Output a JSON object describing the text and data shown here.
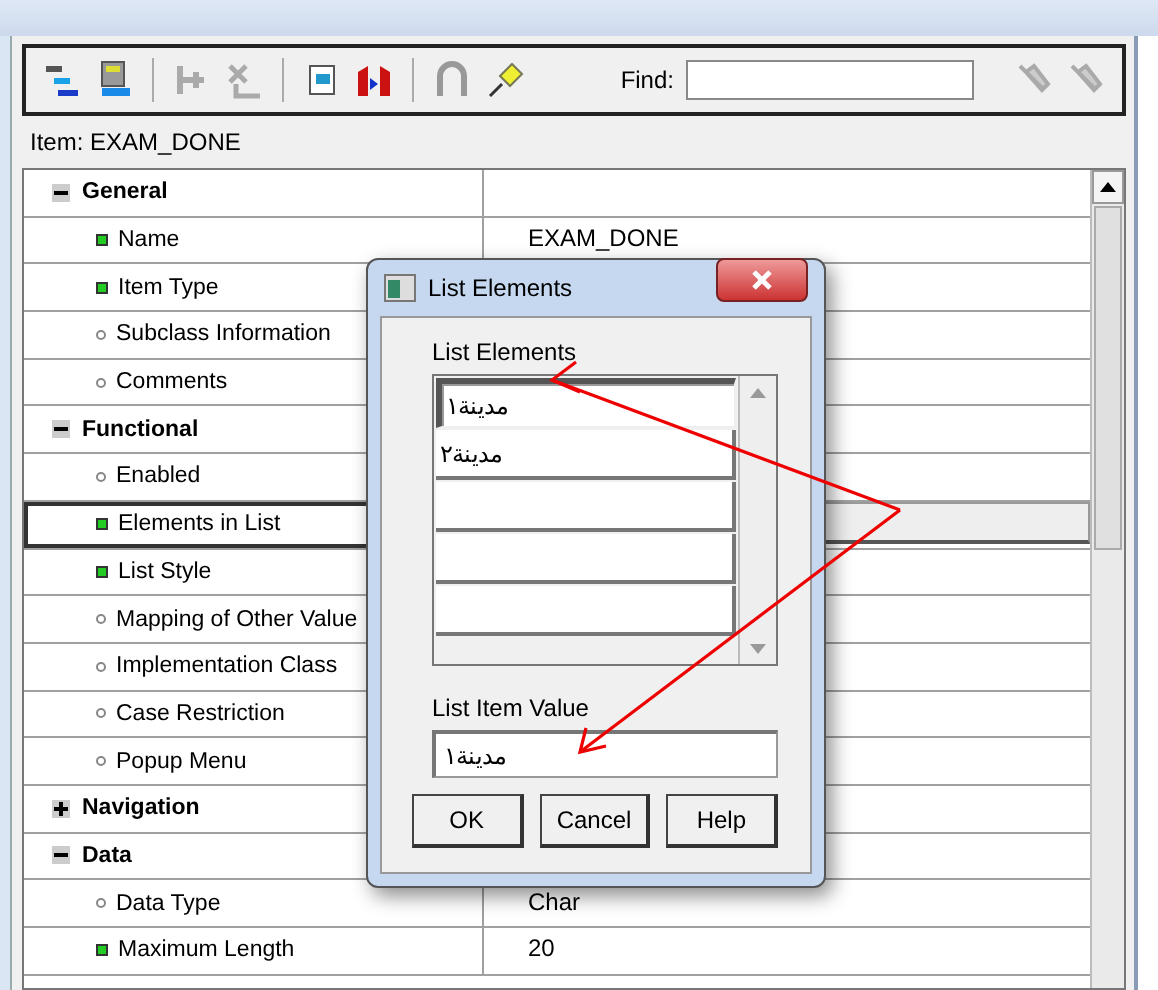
{
  "toolbar": {
    "find": {
      "label": "Find:"
    }
  },
  "item": {
    "label": "Item: EXAM_DONE"
  },
  "properties": [
    {
      "kind": "section",
      "label": "General",
      "expanded": true
    },
    {
      "kind": "property",
      "label": "Name",
      "changed": true,
      "value": "EXAM_DONE",
      "selected": false
    },
    {
      "kind": "property",
      "label": "Item Type",
      "changed": true,
      "selected": false
    },
    {
      "kind": "property",
      "label": "Subclass Information",
      "changed": false,
      "selected": false
    },
    {
      "kind": "property",
      "label": "Comments",
      "changed": false,
      "selected": false
    },
    {
      "kind": "section",
      "label": "Functional",
      "expanded": true
    },
    {
      "kind": "property",
      "label": "Enabled",
      "changed": false,
      "selected": false
    },
    {
      "kind": "property",
      "label": "Elements in List",
      "changed": true,
      "selected": true
    },
    {
      "kind": "property",
      "label": "List Style",
      "changed": true,
      "selected": false
    },
    {
      "kind": "property",
      "label": "Mapping of Other Value",
      "changed": false,
      "selected": false
    },
    {
      "kind": "property",
      "label": "Implementation Class",
      "changed": false,
      "selected": false
    },
    {
      "kind": "property",
      "label": "Case Restriction",
      "changed": false,
      "selected": false
    },
    {
      "kind": "property",
      "label": "Popup Menu",
      "changed": false,
      "selected": false
    },
    {
      "kind": "section",
      "label": "Navigation",
      "expanded": false
    },
    {
      "kind": "section",
      "label": "Data",
      "expanded": true
    },
    {
      "kind": "property",
      "label": "Data Type",
      "changed": false,
      "value": "Char",
      "selected": false
    },
    {
      "kind": "property",
      "label": "Maximum Length",
      "changed": true,
      "value": "20",
      "selected": false
    }
  ],
  "dialog": {
    "title": "List Elements",
    "list_label": {
      "text": "List Elements"
    },
    "elements": [
      {
        "value": "مدينة١",
        "selected": true
      },
      {
        "value": "مدينة٢",
        "selected": false
      }
    ],
    "value_label": {
      "text": "List Item Value"
    },
    "value": "مدينة١",
    "buttons": [
      {
        "label": "OK"
      },
      {
        "label": "Cancel"
      },
      {
        "label": "Help"
      }
    ]
  }
}
